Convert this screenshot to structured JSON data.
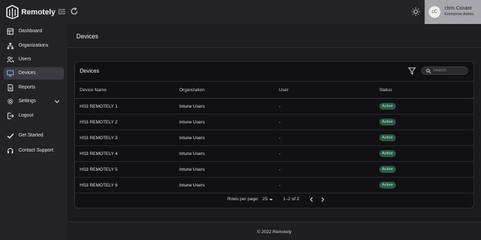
{
  "app": {
    "brand": "Remotely"
  },
  "user": {
    "initials": "cC",
    "name": "chris Conant",
    "role": "Enterprise Admin"
  },
  "sidebar": {
    "items": [
      {
        "label": "Dashboard",
        "icon": "dashboard-icon"
      },
      {
        "label": "Organizations",
        "icon": "organizations-icon"
      },
      {
        "label": "Users",
        "icon": "users-icon"
      },
      {
        "label": "Devices",
        "icon": "monitor-icon",
        "active": true
      },
      {
        "label": "Reports",
        "icon": "report-icon"
      },
      {
        "label": "Settings",
        "icon": "gear-icon"
      },
      {
        "label": "Logout",
        "icon": "logout-icon"
      },
      {
        "label": "Get Started",
        "icon": "check-icon"
      },
      {
        "label": "Contact Support",
        "icon": "headset-icon"
      }
    ]
  },
  "page": {
    "title": "Devices"
  },
  "card": {
    "title": "Devices"
  },
  "search": {
    "placeholder": "Search"
  },
  "table": {
    "columns": [
      "Device Name",
      "Organization",
      "User",
      "Status"
    ],
    "rows": [
      [
        "HS3 REMOTELY 1",
        "Intune Users",
        "-",
        "Active"
      ],
      [
        "HS3 REMOTELY 2",
        "Intune Users",
        "-",
        "Active"
      ],
      [
        "HS3 REMOTELY 3",
        "Intune Users",
        "-",
        "Active"
      ],
      [
        "HS3 REMOTELY 4",
        "Intune Users",
        "-",
        "Active"
      ],
      [
        "HS3 REMOTELY 5",
        "Intune Users",
        "-",
        "Active"
      ],
      [
        "HS3 REMOTELY 6",
        "Intune Users",
        "-",
        "Active"
      ]
    ]
  },
  "pagination": {
    "rows_label": "Rows per page:",
    "rows_value": "25",
    "range": "1–2 of 2"
  },
  "footer": {
    "text": "© 2022 Remotely"
  },
  "colors": {
    "accent_badge": "#2d5a47",
    "active_nav": "#3b3b40",
    "user_box": "#a7a7ab"
  }
}
